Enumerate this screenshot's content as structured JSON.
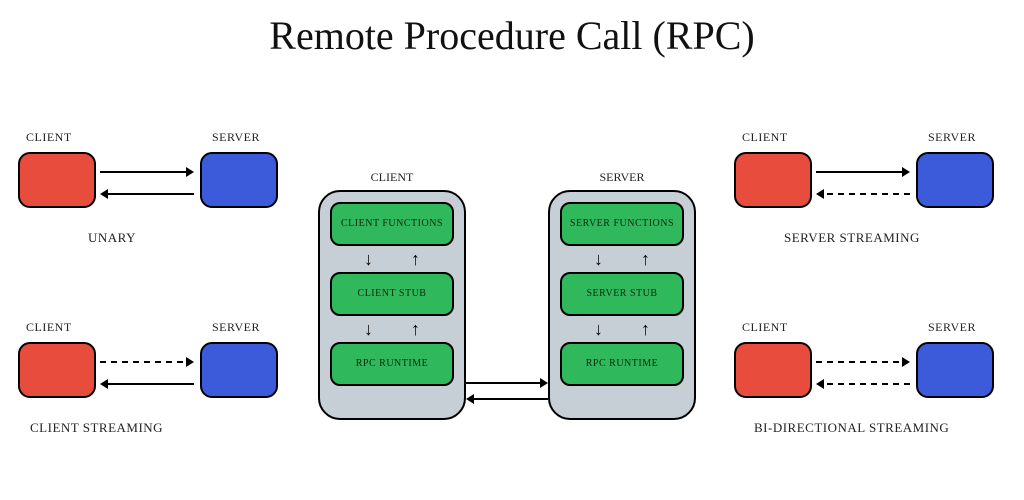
{
  "title": "Remote Procedure Call (RPC)",
  "labels": {
    "client": "CLIENT",
    "server": "SERVER"
  },
  "quadrants": {
    "unary": {
      "caption": "UNARY",
      "req": "solid",
      "res": "solid"
    },
    "client_streaming": {
      "caption": "CLIENT STREAMING",
      "req": "dashed",
      "res": "solid"
    },
    "server_streaming": {
      "caption": "SERVER STREAMING",
      "req": "solid",
      "res": "dashed"
    },
    "bidirectional": {
      "caption": "BI-DIRECTIONAL STREAMING",
      "req": "dashed",
      "res": "dashed"
    }
  },
  "architecture": {
    "client": {
      "title": "CLIENT",
      "layers": [
        "CLIENT FUNCTIONS",
        "CLIENT STUB",
        "RPC RUNTIME"
      ]
    },
    "server": {
      "title": "SERVER",
      "layers": [
        "SERVER FUNCTIONS",
        "SERVER STUB",
        "RPC RUNTIME"
      ]
    }
  },
  "colors": {
    "client_box": "#e74c3c",
    "server_box": "#3b5bdb",
    "green_box": "#2fb85c",
    "grey_panel": "#c7cfd6"
  }
}
